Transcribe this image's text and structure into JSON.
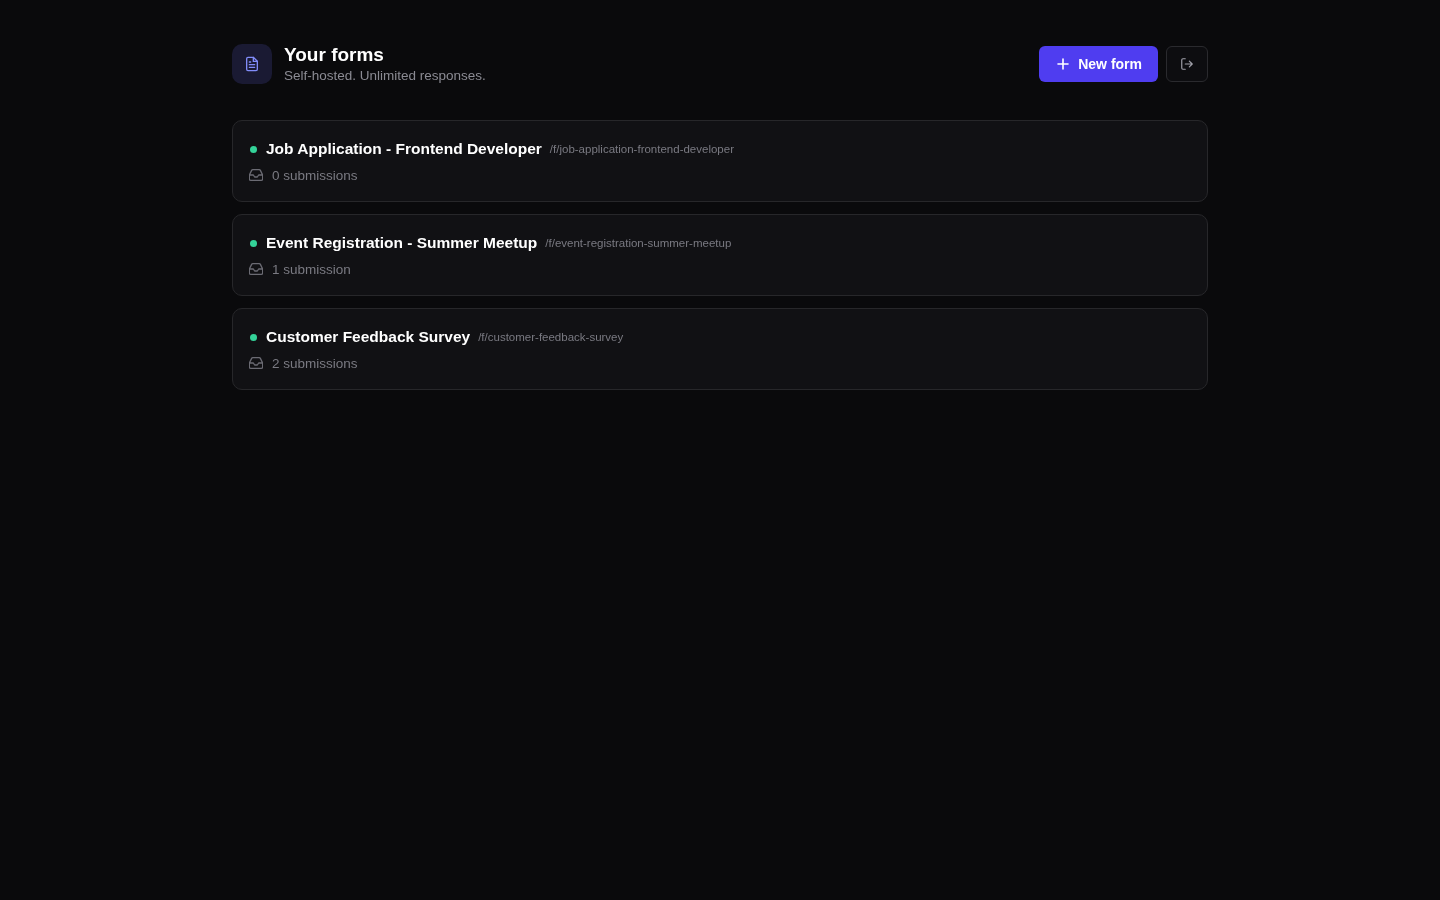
{
  "header": {
    "title": "Your forms",
    "subtitle": "Self-hosted. Unlimited responses.",
    "new_button": "New form"
  },
  "forms": [
    {
      "title": "Job Application - Frontend Developer",
      "slug": "/f/job-application-frontend-developer",
      "submissions": "0 submissions",
      "color": "#34d399"
    },
    {
      "title": "Event Registration - Summer Meetup",
      "slug": "/f/event-registration-summer-meetup",
      "submissions": "1 submission",
      "color": "#34d399"
    },
    {
      "title": "Customer Feedback Survey",
      "slug": "/f/customer-feedback-survey",
      "submissions": "2 submissions",
      "color": "#34d399"
    }
  ]
}
